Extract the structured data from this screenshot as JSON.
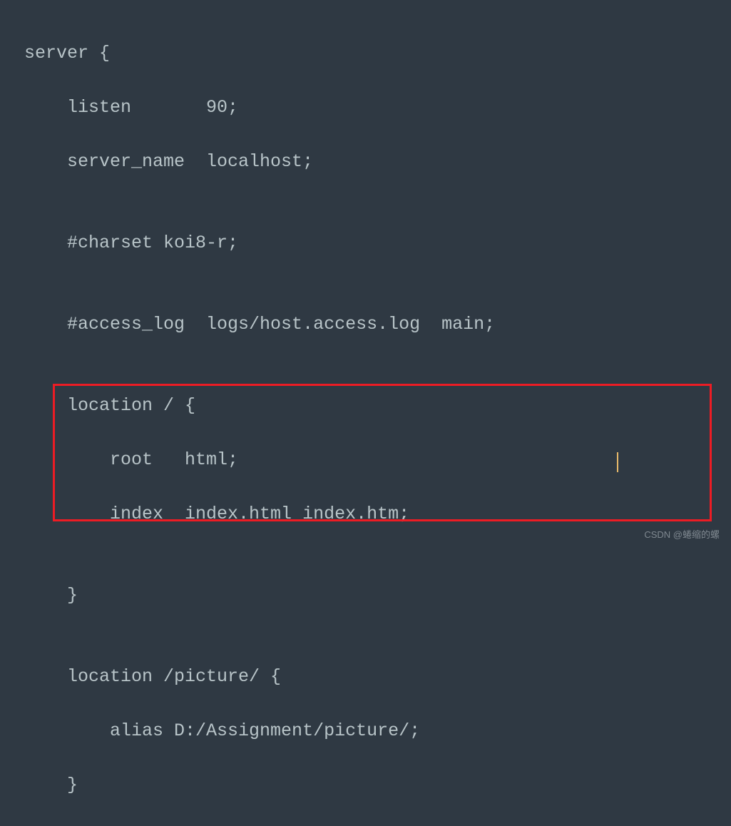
{
  "code": {
    "line1": "server {",
    "line2": "    listen       90;",
    "line3": "    server_name  localhost;",
    "line4": "",
    "line5": "    #charset koi8-r;",
    "line6": "",
    "line7": "    #access_log  logs/host.access.log  main;",
    "line8": "",
    "line9": "    location / {",
    "line10": "        root   html;",
    "line11": "        index  index.html index.htm;",
    "line12": "",
    "line13": "    }",
    "line14": "",
    "line15": "    location /picture/ {",
    "line16": "        alias D:/Assignment/picture/;",
    "line17": "    }"
  },
  "watermark": "CSDN @蜷缩的螺"
}
